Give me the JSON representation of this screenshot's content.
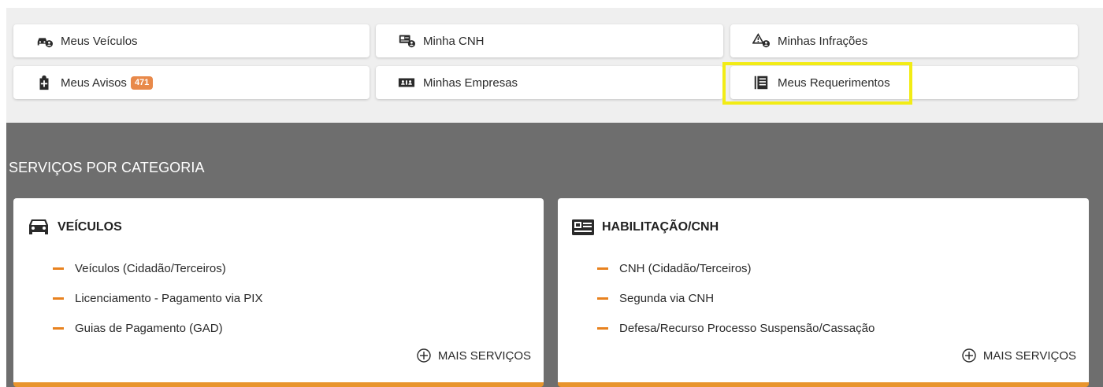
{
  "quick_access": {
    "veiculos": {
      "label": "Meus Veículos",
      "icon": "car-user-icon"
    },
    "cnh": {
      "label": "Minha CNH",
      "icon": "license-user-icon"
    },
    "infracoes": {
      "label": "Minhas Infrações",
      "icon": "warning-user-icon"
    },
    "avisos": {
      "label": "Meus Avisos",
      "badge": "471",
      "icon": "notice-plus-icon"
    },
    "empresas": {
      "label": "Minhas Empresas",
      "icon": "company-icon"
    },
    "requerimentos": {
      "label": "Meus Requerimentos",
      "icon": "document-list-icon"
    }
  },
  "categories": {
    "title": "SERVIÇOS POR CATEGORIA",
    "veiculos": {
      "title": "VEÍCULOS",
      "icon": "car-icon",
      "items": [
        "Veículos (Cidadão/Terceiros)",
        "Licenciamento - Pagamento via PIX",
        "Guias de Pagamento (GAD)"
      ],
      "more": "MAIS SERVIÇOS"
    },
    "habilitacao": {
      "title": "HABILITAÇÃO/CNH",
      "icon": "id-card-icon",
      "items": [
        "CNH (Cidadão/Terceiros)",
        "Segunda via CNH",
        "Defesa/Recurso Processo Suspensão/Cassação"
      ],
      "more": "MAIS SERVIÇOS"
    }
  },
  "colors": {
    "accent": "#e8942d",
    "badge": "#e8894a",
    "highlight": "#f2ec15",
    "category_bg": "#6e6e6e"
  }
}
